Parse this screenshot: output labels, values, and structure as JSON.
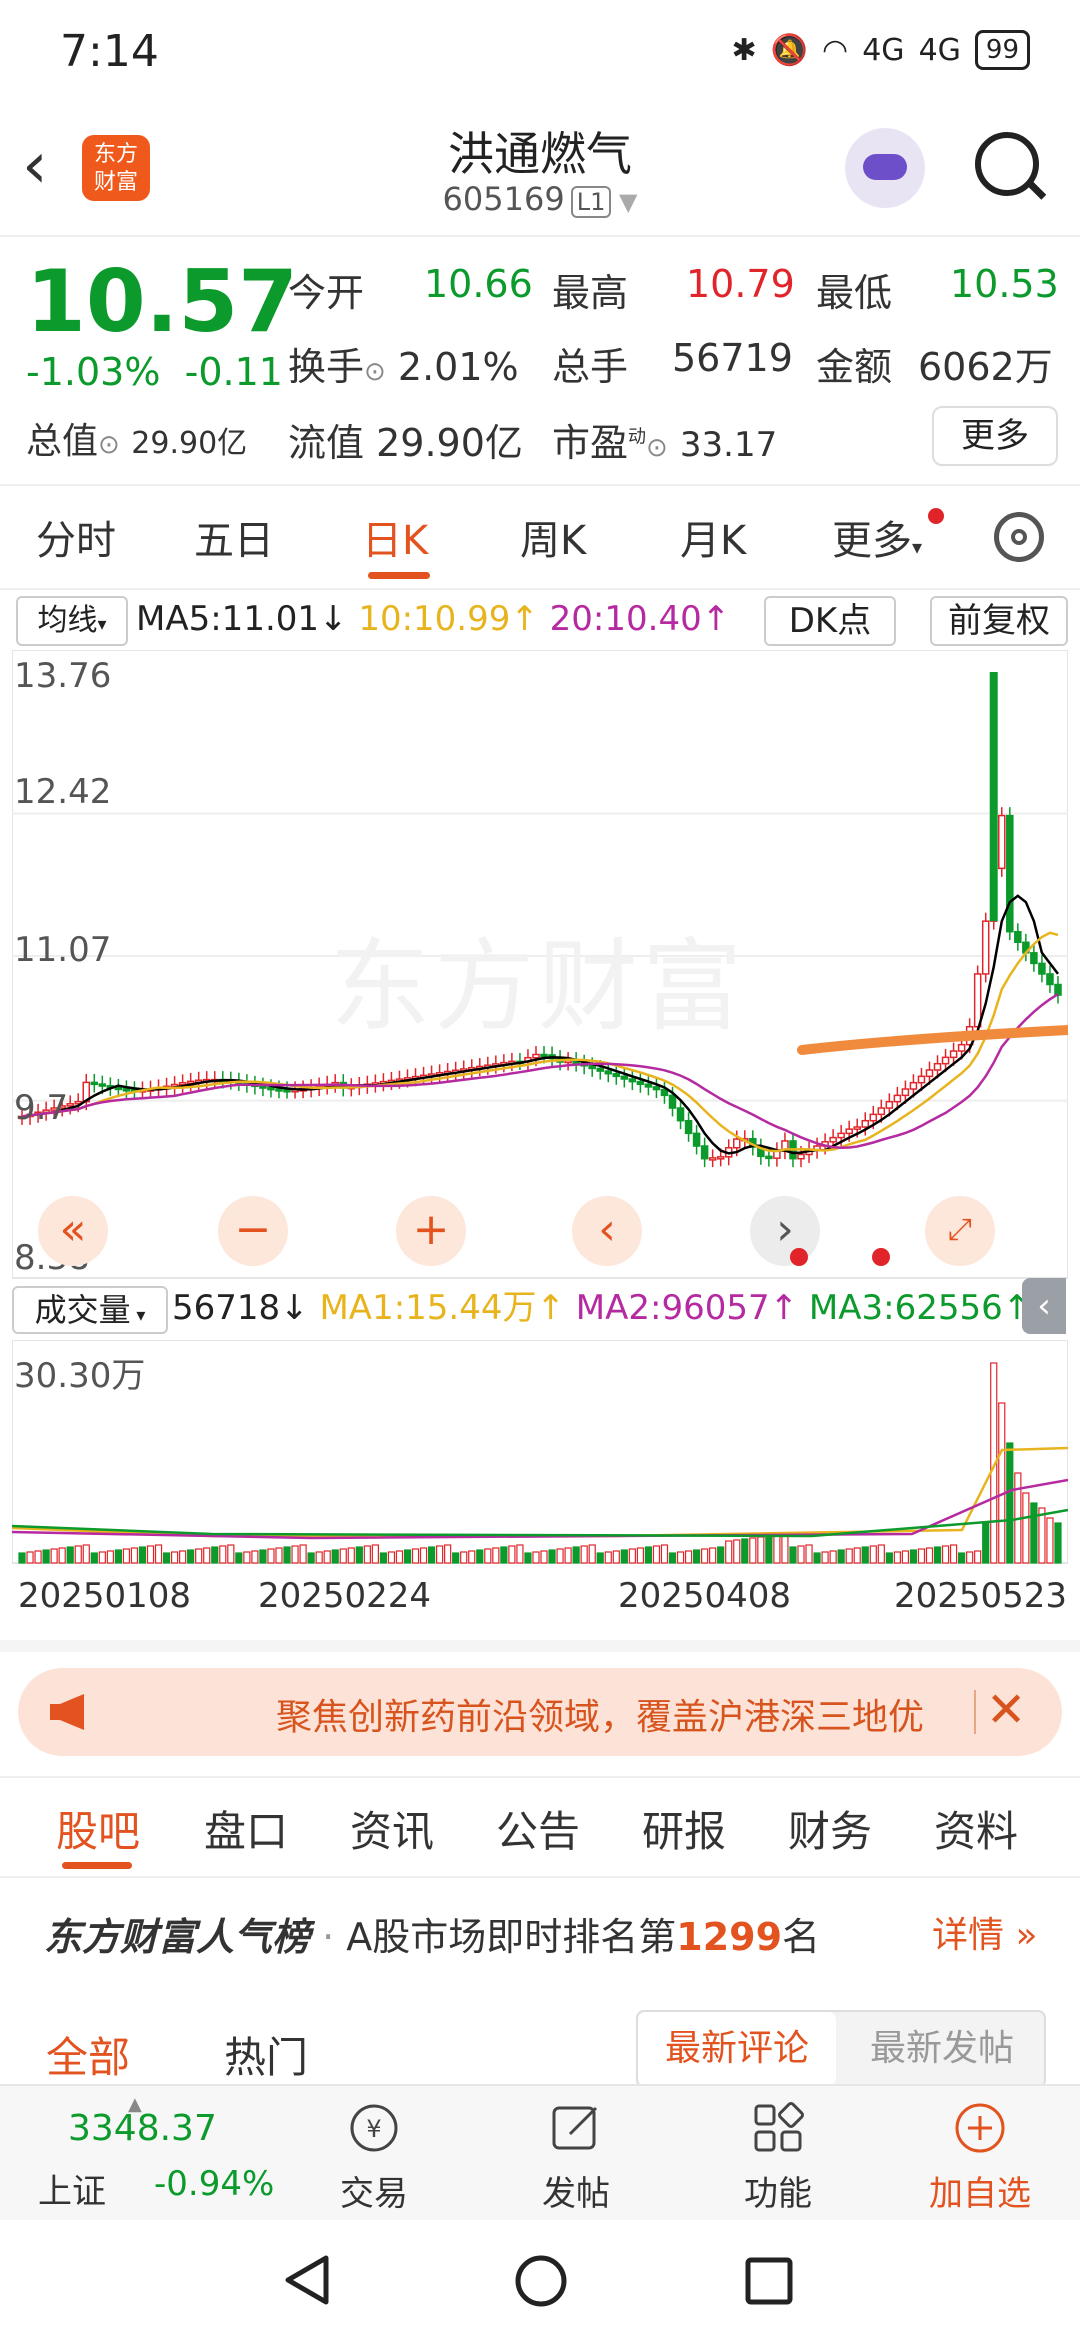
{
  "status": {
    "time": "7:14",
    "signal1": "4G",
    "signal2": "4G",
    "battery": "99"
  },
  "header": {
    "title": "洪通燃气",
    "code": "605169",
    "tag": "L1",
    "logo_line1": "东方",
    "logo_line2": "财富"
  },
  "quote": {
    "price": "10.57",
    "change_pct": "-1.03%",
    "change": "-0.11",
    "open_label": "今开",
    "open": "10.66",
    "high_label": "最高",
    "high": "10.79",
    "low_label": "最低",
    "low": "10.53",
    "turnover_label": "换手",
    "turnover": "2.01%",
    "volume_label": "总手",
    "volume": "56719",
    "amount_label": "金额",
    "amount": "6062万",
    "mktcap_label": "总值",
    "mktcap": "29.90亿",
    "float_label": "流值",
    "float": "29.90亿",
    "pe_label": "市盈",
    "pe_sup": "动",
    "pe": "33.17",
    "more": "更多"
  },
  "period_tabs": [
    "分时",
    "五日",
    "日K",
    "周K",
    "月K",
    "更多"
  ],
  "ma": {
    "label": "均线",
    "ma5": "MA5:11.01",
    "ma10": "10:10.99",
    "ma20": "20:10.40",
    "dk": "DK点",
    "adjust": "前复权"
  },
  "kaxis": [
    "13.76",
    "12.42",
    "11.07",
    "9.7",
    "8.38"
  ],
  "watermark": "东方财富",
  "volume": {
    "label": "成交量",
    "value": "56718",
    "ma1": "MA1:15.44万",
    "ma2": "MA2:96057",
    "ma3": "MA3:62556",
    "axis_max": "30.30万"
  },
  "dates": [
    "20250108",
    "20250224",
    "20250408",
    "20250523"
  ],
  "banner": {
    "text": "聚焦创新药前沿领域，覆盖沪港深三地优"
  },
  "bottom_tabs": [
    "股吧",
    "盘口",
    "资讯",
    "公告",
    "研报",
    "财务",
    "资料"
  ],
  "rank": {
    "brand": "东方财富人气榜",
    "prefix": "A股市场即时排名第",
    "num": "1299",
    "suffix": "名",
    "detail": "详情"
  },
  "feed_tabs": {
    "all": "全部",
    "hot": "热门",
    "latest_comment": "最新评论",
    "latest_post": "最新发帖"
  },
  "bottombar": {
    "index_value": "3348.37",
    "index_name": "上证",
    "index_change": "-0.94%",
    "trade": "交易",
    "post": "发帖",
    "func": "功能",
    "add": "加自选"
  },
  "colors": {
    "up": "#e0242a",
    "down": "#0b9a2b",
    "accent": "#e2531f",
    "ma5": "#000000",
    "ma10": "#e8b41e",
    "ma20": "#b52aa0"
  },
  "chart_data": {
    "type": "candlestick",
    "ylim": [
      8.38,
      13.76
    ],
    "y_ticks": [
      13.76,
      12.42,
      11.07,
      9.7,
      8.38
    ],
    "x_ticks": [
      "20250108",
      "20250224",
      "20250408",
      "20250523"
    ],
    "ma_values": {
      "MA5": 11.01,
      "MA10": 10.99,
      "MA20": 10.4
    },
    "volume_ylim_label": "30.30万"
  }
}
